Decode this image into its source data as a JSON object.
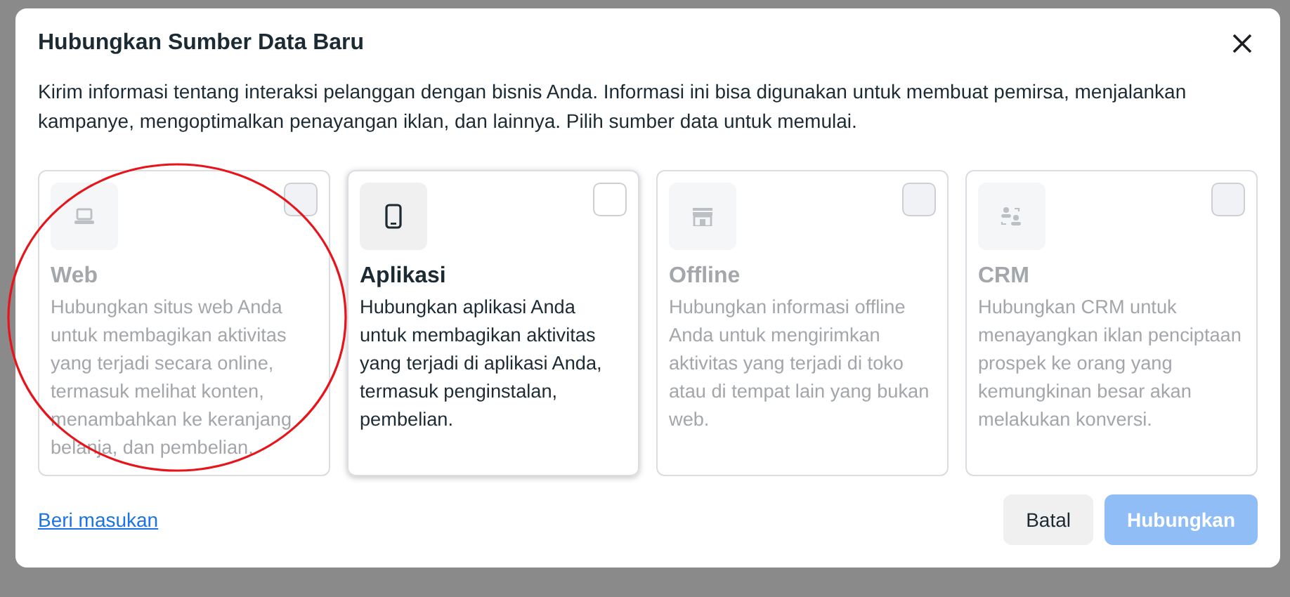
{
  "dialog": {
    "title": "Hubungkan Sumber Data Baru",
    "description": "Kirim informasi tentang interaksi pelanggan dengan bisnis Anda. Informasi ini bisa digunakan untuk membuat pemirsa, menjalankan kampanye, mengoptimalkan penayangan iklan, dan lainnya. Pilih sumber data untuk memulai.",
    "sources": [
      {
        "kind": "web",
        "title": "Web",
        "description": "Hubungkan situs web Anda untuk membagikan aktivitas yang terjadi secara online, termasuk melihat konten, menambahkan ke keranjang belanja, dan pembelian.",
        "disabled": true,
        "checked": false
      },
      {
        "kind": "app",
        "title": "Aplikasi",
        "description": "Hubungkan aplikasi Anda untuk membagikan aktivitas yang terjadi di aplikasi Anda, termasuk penginstalan, pembelian.",
        "disabled": false,
        "checked": false
      },
      {
        "kind": "offline",
        "title": "Offline",
        "description": "Hubungkan informasi offline Anda untuk mengirimkan aktivitas yang terjadi di toko atau di tempat lain yang bukan web.",
        "disabled": true,
        "checked": false
      },
      {
        "kind": "crm",
        "title": "CRM",
        "description": "Hubungkan CRM untuk menayangkan iklan penciptaan prospek ke orang yang kemungkinan besar akan melakukan konversi.",
        "disabled": true,
        "checked": false
      }
    ],
    "feedback_link": "Beri masukan",
    "buttons": [
      {
        "label": "Batal",
        "kind": "secondary",
        "disabled": false
      },
      {
        "label": "Hubungkan",
        "kind": "primary",
        "disabled": true
      }
    ]
  },
  "annotations": [
    {
      "kind": "circle"
    }
  ]
}
